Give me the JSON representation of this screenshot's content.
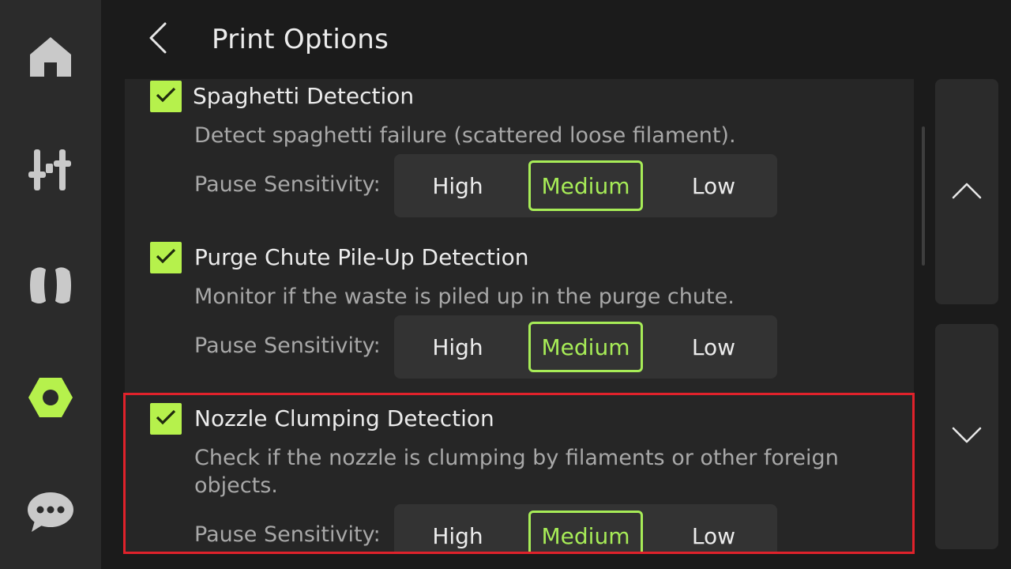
{
  "header": {
    "title": "Print Options"
  },
  "nav": {
    "items": [
      {
        "name": "home",
        "icon": "home-icon",
        "active": false
      },
      {
        "name": "controls",
        "icon": "sliders-icon",
        "active": false
      },
      {
        "name": "filament",
        "icon": "filament-spool-icon",
        "active": false
      },
      {
        "name": "settings",
        "icon": "hex-nut-settings-icon",
        "active": true
      },
      {
        "name": "messages",
        "icon": "chat-bubble-icon",
        "active": false
      }
    ]
  },
  "options": [
    {
      "title": "Spaghetti Detection",
      "description": "Detect spaghetti failure (scattered loose filament).",
      "checked": true,
      "sensitivity_label": "Pause Sensitivity:",
      "levels": [
        "High",
        "Medium",
        "Low"
      ],
      "selected": "Medium"
    },
    {
      "title": "Purge Chute Pile-Up Detection",
      "description": "Monitor if the waste is piled up in the purge chute.",
      "checked": true,
      "sensitivity_label": "Pause Sensitivity:",
      "levels": [
        "High",
        "Medium",
        "Low"
      ],
      "selected": "Medium"
    },
    {
      "title": "Nozzle Clumping Detection",
      "description": "Check if the nozzle is clumping by filaments or other foreign objects.",
      "checked": true,
      "sensitivity_label": "Pause Sensitivity:",
      "levels": [
        "High",
        "Medium",
        "Low"
      ],
      "selected": "Medium"
    }
  ],
  "colors": {
    "accent": "#b6f14c",
    "highlight": "#e0222b",
    "background": "#1b1b1b",
    "panel": "#262626"
  },
  "scroll": {
    "up_icon": "chevron-up-icon",
    "down_icon": "chevron-down-icon"
  }
}
